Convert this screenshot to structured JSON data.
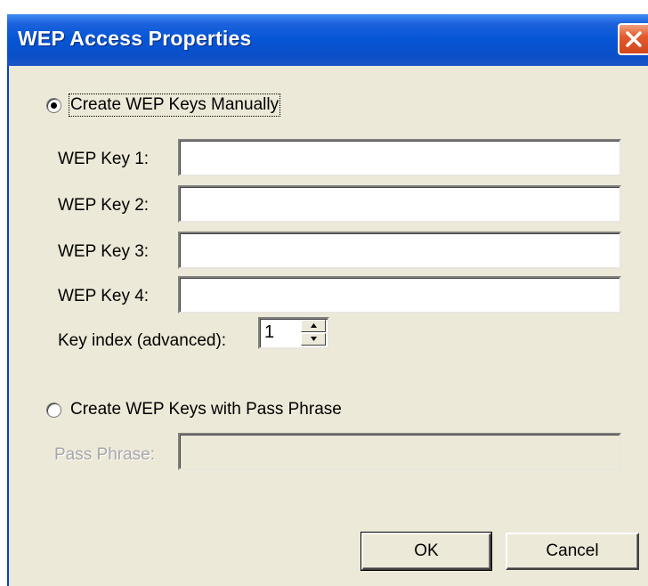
{
  "window": {
    "title": "WEP Access Properties",
    "close_icon": "close-icon"
  },
  "manual": {
    "radio_label": "Create WEP Keys Manually",
    "selected": true,
    "keys": [
      {
        "label": "WEP Key 1:",
        "value": ""
      },
      {
        "label": "WEP Key 2:",
        "value": ""
      },
      {
        "label": "WEP Key 3:",
        "value": ""
      },
      {
        "label": "WEP Key 4:",
        "value": ""
      }
    ],
    "key_index_label": "Key index (advanced):",
    "key_index_value": "1"
  },
  "passphrase": {
    "radio_label": "Create WEP Keys with Pass Phrase",
    "selected": false,
    "field_label": "Pass Phrase:",
    "field_value": ""
  },
  "buttons": {
    "ok": "OK",
    "cancel": "Cancel"
  },
  "colors": {
    "titlebar": "#0656d6",
    "dialog_bg": "#ece9d8",
    "close_button": "#e35b2c"
  }
}
